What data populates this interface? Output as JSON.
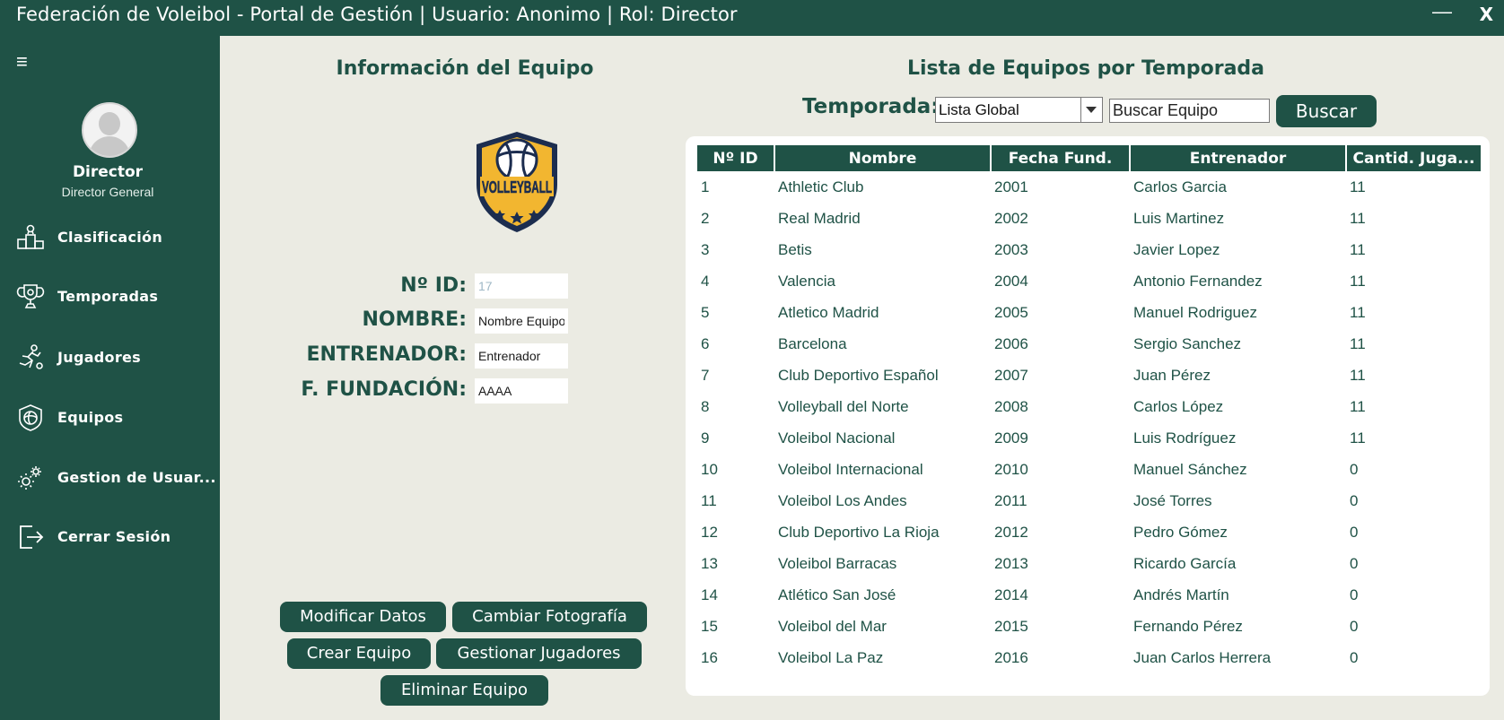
{
  "window": {
    "title": "Federación de Voleibol - Portal de Gestión | Usuario: Anonimo | Rol: Director",
    "minimize_label": "—",
    "close_label": "X"
  },
  "sidebar": {
    "menu_icon": "≡",
    "user_role": "Director",
    "user_title": "Director General",
    "items": [
      {
        "label": "Clasificación",
        "icon": "podium-icon"
      },
      {
        "label": "Temporadas",
        "icon": "trophy-icon"
      },
      {
        "label": "Jugadores",
        "icon": "player-icon"
      },
      {
        "label": "Equipos",
        "icon": "ball-badge-icon"
      },
      {
        "label": "Gestion de Usuar...",
        "icon": "gears-icon"
      },
      {
        "label": "Cerrar Sesión",
        "icon": "logout-icon"
      }
    ]
  },
  "team_info": {
    "title": "Información del Equipo",
    "logo_text": "VOLLEYBALL",
    "fields": {
      "id_label": "Nº ID:",
      "id_placeholder": "17",
      "name_label": "NOMBRE:",
      "name_value": "Nombre Equipo",
      "coach_label": "ENTRENADOR:",
      "coach_value": "Entrenador",
      "founded_label": "F. FUNDACIÓN:",
      "founded_value": "AAAA"
    },
    "buttons": {
      "modify": "Modificar Datos",
      "change_photo": "Cambiar Fotografía",
      "create": "Crear Equipo",
      "manage_players": "Gestionar Jugadores",
      "delete": "Eliminar Equipo"
    }
  },
  "team_list": {
    "title": "Lista de Equipos por Temporada",
    "season_label": "Temporada:",
    "season_selected": "Lista Global",
    "search_value": "Buscar Equipo",
    "search_button": "Buscar",
    "columns": [
      "Nº ID",
      "Nombre",
      "Fecha Fund.",
      "Entrenador",
      "Cantid. Juga..."
    ],
    "rows": [
      [
        "1",
        "Athletic Club",
        "2001",
        "Carlos Garcia",
        "11"
      ],
      [
        "2",
        "Real Madrid",
        "2002",
        "Luis Martinez",
        "11"
      ],
      [
        "3",
        "Betis",
        "2003",
        "Javier Lopez",
        "11"
      ],
      [
        "4",
        "Valencia",
        "2004",
        "Antonio Fernandez",
        "11"
      ],
      [
        "5",
        "Atletico Madrid",
        "2005",
        "Manuel Rodriguez",
        "11"
      ],
      [
        "6",
        "Barcelona",
        "2006",
        "Sergio Sanchez",
        "11"
      ],
      [
        "7",
        "Club Deportivo Español",
        "2007",
        "Juan Pérez",
        "11"
      ],
      [
        "8",
        "Volleyball del Norte",
        "2008",
        "Carlos López",
        "11"
      ],
      [
        "9",
        "Voleibol Nacional",
        "2009",
        "Luis Rodríguez",
        "11"
      ],
      [
        "10",
        "Voleibol Internacional",
        "2010",
        "Manuel Sánchez",
        "0"
      ],
      [
        "11",
        "Voleibol Los Andes",
        "2011",
        "José Torres",
        "0"
      ],
      [
        "12",
        "Club Deportivo La Rioja",
        "2012",
        "Pedro Gómez",
        "0"
      ],
      [
        "13",
        "Voleibol Barracas",
        "2013",
        "Ricardo García",
        "0"
      ],
      [
        "14",
        "Atlético San José",
        "2014",
        "Andrés Martín",
        "0"
      ],
      [
        "15",
        "Voleibol del Mar",
        "2015",
        "Fernando Pérez",
        "0"
      ],
      [
        "16",
        "Voleibol La Paz",
        "2016",
        "Juan Carlos Herrera",
        "0"
      ]
    ]
  },
  "colors": {
    "primary": "#1f5246",
    "background": "#ebebe3",
    "logo_gold": "#f2b630",
    "logo_navy": "#1c2d4f"
  }
}
